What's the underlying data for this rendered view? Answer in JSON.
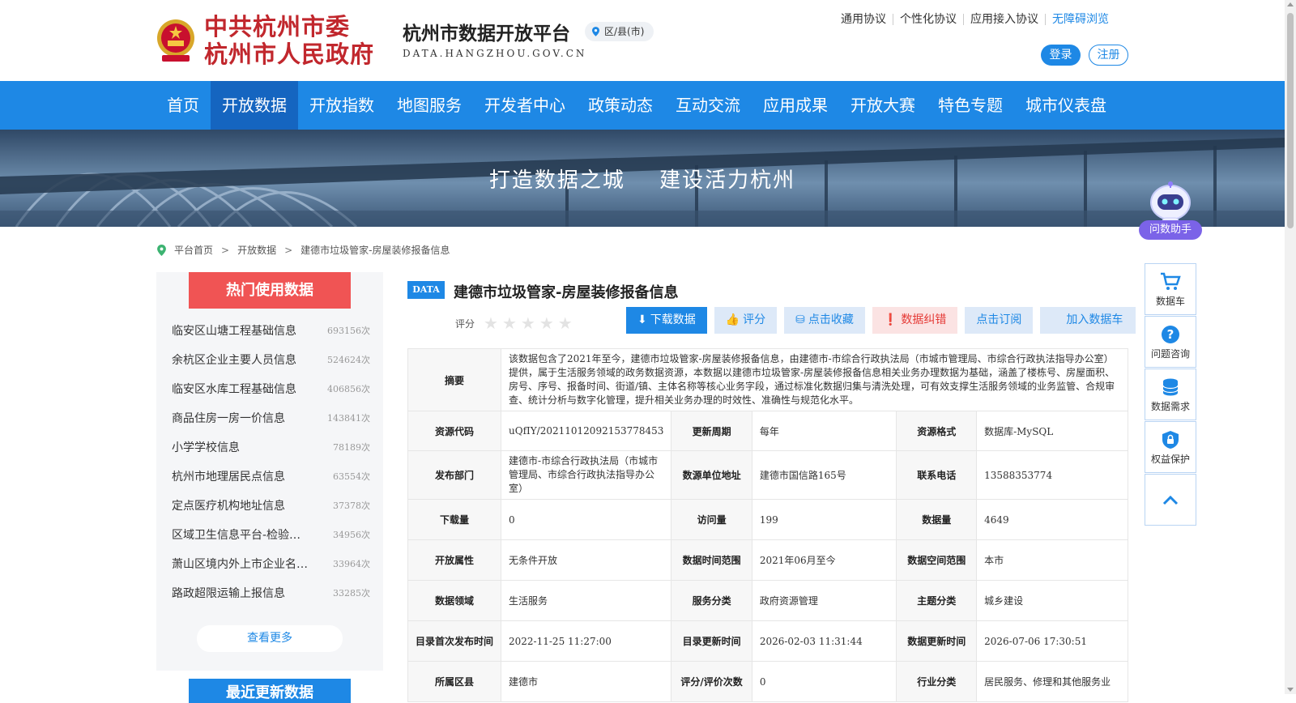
{
  "header": {
    "gov_line1": "中共杭州市委",
    "gov_line2": "杭州市人民政府",
    "platform_title": "杭州市数据开放平台",
    "platform_url": "DATA.HANGZHOU.GOV.CN",
    "region": "区/县(市)",
    "links": [
      "通用协议",
      "个性化协议",
      "应用接入协议",
      "无障碍浏览"
    ],
    "login": "登录",
    "register": "注册"
  },
  "nav": {
    "items": [
      "首页",
      "开放数据",
      "开放指数",
      "地图服务",
      "开发者中心",
      "政策动态",
      "互动交流",
      "应用成果",
      "开放大赛",
      "特色专题",
      "城市仪表盘"
    ],
    "active": "开放数据"
  },
  "banner": {
    "slogan_left": "打造数据之城",
    "slogan_right": "建设活力杭州"
  },
  "breadcrumb": {
    "items": [
      "平台首页",
      "开放数据",
      "建德市垃圾管家-房屋装修报备信息"
    ],
    "sep": ">"
  },
  "sidebar": {
    "hot_title": "热门使用数据",
    "hot_items": [
      {
        "name": "临安区山塘工程基础信息",
        "count": "693156次"
      },
      {
        "name": "余杭区企业主要人员信息",
        "count": "524624次"
      },
      {
        "name": "临安区水库工程基础信息",
        "count": "406856次"
      },
      {
        "name": "商品住房一房一价信息",
        "count": "143841次"
      },
      {
        "name": "小学学校信息",
        "count": "78189次"
      },
      {
        "name": "杭州市地理居民点信息",
        "count": "63554次"
      },
      {
        "name": "定点医疗机构地址信息",
        "count": "37378次"
      },
      {
        "name": "区域卫生信息平台-检验…",
        "count": "34956次"
      },
      {
        "name": "萧山区境内外上市企业名…",
        "count": "33964次"
      },
      {
        "name": "路政超限运输上报信息",
        "count": "33285次"
      }
    ],
    "more": "查看更多",
    "recent_title": "最近更新数据"
  },
  "dataset": {
    "tag": "DATA",
    "title": "建德市垃圾管家-房屋装修报备信息",
    "rating_label": "评分",
    "rating_value": 0,
    "actions": {
      "download": "下载数据",
      "rate": "评分",
      "favorite": "点击收藏",
      "report": "数据纠错",
      "subscribe": "点击订阅",
      "cart": "加入数据车"
    },
    "summary_label": "摘要",
    "summary": "该数据包含了2021年至今，建德市垃圾管家-房屋装修报备信息，由建德市-市综合行政执法局（市城市管理局、市综合行政执法指导办公室）提供，属于生活服务领域的政务数据资源，本数据以建德市垃圾管家-房屋装修报备信息相关业务办理数据为基础，涵盖了楼栋号、房屋面积、房号、序号、报备时间、街道/镇、主体名称等核心业务字段，通过标准化数据归集与清洗处理，可有效支撑生活服务领域的业务监管、合规审查、统计分析与数字化管理，提升相关业务办理的时效性、准确性与规范化水平。",
    "rows": [
      [
        {
          "l": "资源代码",
          "v": "uQfIY/20211012092153778453"
        },
        {
          "l": "更新周期",
          "v": "每年"
        },
        {
          "l": "资源格式",
          "v": "数据库-MySQL"
        }
      ],
      [
        {
          "l": "发布部门",
          "v": "建德市-市综合行政执法局（市城市管理局、市综合行政执法指导办公室）"
        },
        {
          "l": "数源单位地址",
          "v": "建德市国信路165号"
        },
        {
          "l": "联系电话",
          "v": "13588353774"
        }
      ],
      [
        {
          "l": "下载量",
          "v": "0"
        },
        {
          "l": "访问量",
          "v": "199"
        },
        {
          "l": "数据量",
          "v": "4649"
        }
      ],
      [
        {
          "l": "开放属性",
          "v": "无条件开放"
        },
        {
          "l": "数据时间范围",
          "v": "2021年06月至今"
        },
        {
          "l": "数据空间范围",
          "v": "本市"
        }
      ],
      [
        {
          "l": "数据领域",
          "v": "生活服务"
        },
        {
          "l": "服务分类",
          "v": "政府资源管理"
        },
        {
          "l": "主题分类",
          "v": "城乡建设"
        }
      ],
      [
        {
          "l": "目录首次发布时间",
          "v": "2022-11-25 11:27:00"
        },
        {
          "l": "目录更新时间",
          "v": "2026-02-03 11:31:44"
        },
        {
          "l": "数据更新时间",
          "v": "2026-07-06 17:30:51"
        }
      ],
      [
        {
          "l": "所属区县",
          "v": "建德市"
        },
        {
          "l": "评分/评价次数",
          "v": "0"
        },
        {
          "l": "行业分类",
          "v": "居民服务、修理和其他服务业"
        }
      ]
    ]
  },
  "floatbar": {
    "assistant": "问数助手",
    "items": [
      "数据车",
      "问题咨询",
      "数据需求",
      "权益保护"
    ]
  },
  "colors": {
    "primary": "#1e88e5",
    "nav_active": "#1565c0",
    "hot": "#f05454",
    "assistant": "#7b63e8",
    "gov_red": "#c1272d"
  }
}
